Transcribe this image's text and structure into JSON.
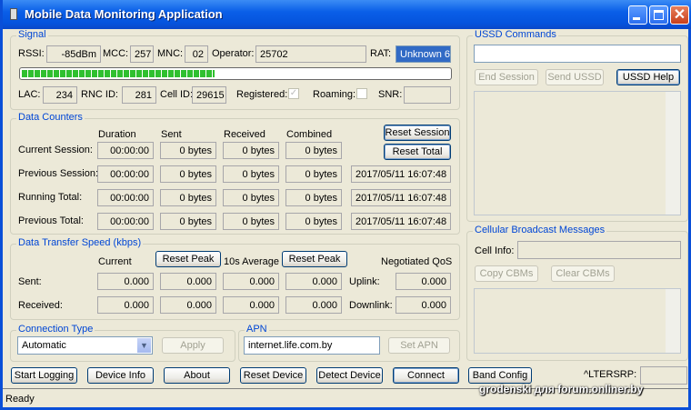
{
  "window": {
    "title": "Mobile Data Monitoring Application"
  },
  "signal": {
    "group": "Signal",
    "rssi_label": "RSSI:",
    "rssi": "-85dBm",
    "mcc_label": "MCC:",
    "mcc": "257",
    "mnc_label": "MNC:",
    "mnc": "02",
    "operator_label": "Operator:",
    "operator": "25702",
    "rat_label": "RAT:",
    "rat": "Unknown 6",
    "signal_fraction": 0.45,
    "lac_label": "LAC:",
    "lac": "234",
    "rnc_label": "RNC ID:",
    "rnc": "281",
    "cell_label": "Cell ID:",
    "cell": "29615",
    "registered_label": "Registered:",
    "registered": true,
    "roaming_label": "Roaming:",
    "roaming": false,
    "snr_label": "SNR:",
    "snr": ""
  },
  "counters": {
    "group": "Data Counters",
    "headers": [
      "Duration",
      "Sent",
      "Received",
      "Combined"
    ],
    "reset_session": "Reset Session",
    "reset_total": "Reset Total",
    "rows": [
      {
        "label": "Current Session:",
        "duration": "00:00:00",
        "sent": "0 bytes",
        "received": "0 bytes",
        "combined": "0 bytes",
        "stamp": null
      },
      {
        "label": "Previous Session:",
        "duration": "00:00:00",
        "sent": "0 bytes",
        "received": "0 bytes",
        "combined": "0 bytes",
        "stamp": "2017/05/11 16:07:48"
      },
      {
        "label": "Running Total:",
        "duration": "00:00:00",
        "sent": "0 bytes",
        "received": "0 bytes",
        "combined": "0 bytes",
        "stamp": "2017/05/11 16:07:48"
      },
      {
        "label": "Previous Total:",
        "duration": "00:00:00",
        "sent": "0 bytes",
        "received": "0 bytes",
        "combined": "0 bytes",
        "stamp": "2017/05/11 16:07:48"
      }
    ]
  },
  "speed": {
    "group": "Data Transfer Speed (kbps)",
    "current": "Current",
    "reset_peak": "Reset Peak",
    "avg": "10s Average",
    "qos": "Negotiated QoS",
    "uplink_label": "Uplink:",
    "downlink_label": "Downlink:",
    "rows": [
      {
        "label": "Sent:",
        "values": [
          "0.000",
          "0.000",
          "0.000",
          "0.000"
        ],
        "qos": "0.000"
      },
      {
        "label": "Received:",
        "values": [
          "0.000",
          "0.000",
          "0.000",
          "0.000"
        ],
        "qos": "0.000"
      }
    ]
  },
  "connection": {
    "group": "Connection Type",
    "value": "Automatic",
    "apply": "Apply"
  },
  "apn": {
    "group": "APN",
    "value": "internet.life.com.by",
    "set": "Set APN"
  },
  "ussd": {
    "group": "USSD Commands",
    "input": "",
    "end": "End Session",
    "send": "Send USSD",
    "help": "USSD Help"
  },
  "cbm": {
    "group": "Cellular Broadcast Messages",
    "cell_info_label": "Cell Info:",
    "cell_info": "",
    "copy": "Copy CBMs",
    "clear": "Clear CBMs"
  },
  "buttons": [
    "Start Logging",
    "Device Info",
    "About",
    "Reset Device",
    "Detect Device",
    "Connect",
    "Band Config"
  ],
  "lterp": {
    "label": "^LTERSRP:",
    "value": ""
  },
  "status": "Ready",
  "watermark": "grodenski для forum.onliner.by"
}
